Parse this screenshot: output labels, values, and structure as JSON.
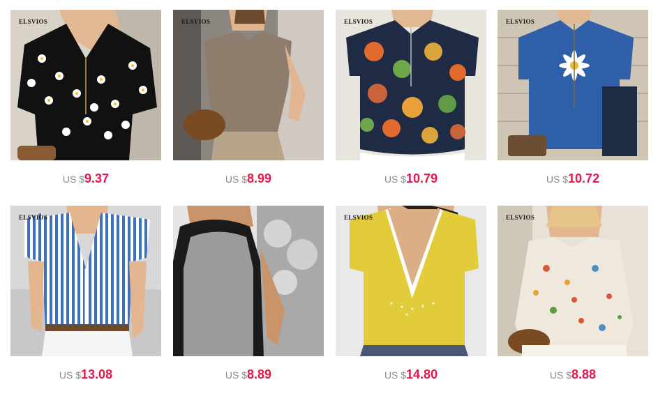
{
  "products": [
    {
      "brand": "ELSVIOS",
      "currency": "US $",
      "price": "9.37",
      "image": "black-daisy-cold-shoulder-top"
    },
    {
      "brand": "ELSVIOS",
      "currency": "US $",
      "price": "8.99",
      "image": "taupe-sleeveless-top"
    },
    {
      "brand": "ELSVIOS",
      "currency": "US $",
      "price": "10.79",
      "image": "navy-floral-print-blouse"
    },
    {
      "brand": "ELSVIOS",
      "currency": "US $",
      "price": "10.72",
      "image": "blue-denim-daisy-tee"
    },
    {
      "brand": "ELSVIOS",
      "currency": "US $",
      "price": "13.08",
      "image": "blue-striped-ruffle-shirt"
    },
    {
      "brand": "",
      "currency": "US $",
      "price": "8.89",
      "image": "gray-racerback-tank"
    },
    {
      "brand": "ELSVIOS",
      "currency": "US $",
      "price": "14.80",
      "image": "yellow-vneck-tee"
    },
    {
      "brand": "ELSVIOS",
      "currency": "US $",
      "price": "8.88",
      "image": "floral-butterfly-cami"
    }
  ]
}
